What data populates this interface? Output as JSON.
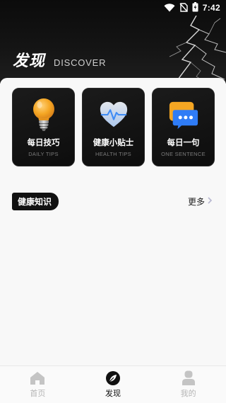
{
  "status_bar": {
    "time": "7:42"
  },
  "header": {
    "title": "发现",
    "subtitle": "DISCOVER"
  },
  "cards": [
    {
      "title": "每日技巧",
      "subtitle": "DAILY TIPS",
      "icon": "lightbulb-icon"
    },
    {
      "title": "健康小贴士",
      "subtitle": "HEALTH TIPS",
      "icon": "heart-pulse-icon"
    },
    {
      "title": "每日一句",
      "subtitle": "ONE SENTENCE",
      "icon": "chat-bubble-icon"
    }
  ],
  "section": {
    "title": "健康知识",
    "more_label": "更多"
  },
  "bottom_nav": {
    "items": [
      {
        "label": "首页",
        "icon": "home-icon",
        "active": false
      },
      {
        "label": "发现",
        "icon": "compass-icon",
        "active": true
      },
      {
        "label": "我的",
        "icon": "profile-icon",
        "active": false
      }
    ]
  },
  "colors": {
    "header_bg": "#0b0b0b",
    "accent": "#111111",
    "inactive": "#b5b5b5",
    "bulb": "#f5a623",
    "chat": "#2f7cf6"
  }
}
